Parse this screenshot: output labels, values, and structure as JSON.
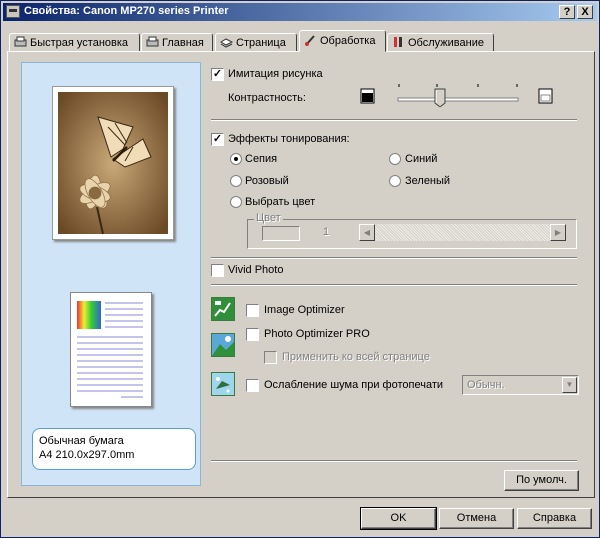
{
  "window": {
    "title": "Свойства: Canon MP270 series Printer",
    "help_button": "?",
    "close_button": "X"
  },
  "tabs": [
    {
      "label": "Быстрая установка",
      "icon": "printer-icon",
      "active": false
    },
    {
      "label": "Главная",
      "icon": "printer-icon",
      "active": false
    },
    {
      "label": "Страница",
      "icon": "pages-icon",
      "active": false
    },
    {
      "label": "Обработка",
      "icon": "brush-icon",
      "active": true
    },
    {
      "label": "Обслуживание",
      "icon": "tools-icon",
      "active": false
    }
  ],
  "preview": {
    "paper_type": "Обычная бумага",
    "paper_size": "A4 210.0x297.0mm"
  },
  "simulate": {
    "label": "Имитация рисунка",
    "checked": true,
    "contrast_label": "Контрастность:",
    "contrast_level": 0.35
  },
  "toning": {
    "label": "Эффекты тонирования:",
    "checked": true,
    "options": [
      {
        "label": "Сепия",
        "selected": true
      },
      {
        "label": "Синий",
        "selected": false
      },
      {
        "label": "Розовый",
        "selected": false
      },
      {
        "label": "Зеленый",
        "selected": false
      },
      {
        "label": "Выбрать цвет",
        "selected": false
      }
    ],
    "color_group_label": "Цвет",
    "color_value": "1"
  },
  "vivid_photo": {
    "label": "Vivid Photo",
    "checked": false
  },
  "image_optimizer": {
    "label": "Image Optimizer",
    "checked": false
  },
  "photo_optimizer": {
    "label": "Photo Optimizer PRO",
    "checked": false,
    "apply_all_label": "Применить ко всей странице"
  },
  "noise_reduction": {
    "label": "Ослабление шума при фотопечати",
    "checked": false,
    "select_value": "Обычн."
  },
  "buttons": {
    "defaults": "По умолч.",
    "ok": "OK",
    "cancel": "Отмена",
    "help": "Справка"
  },
  "colors": {
    "title_start": "#0a246a",
    "title_end": "#a6caf0",
    "preview_bg": "#cfe4f6",
    "sepia": "#b08a58"
  }
}
